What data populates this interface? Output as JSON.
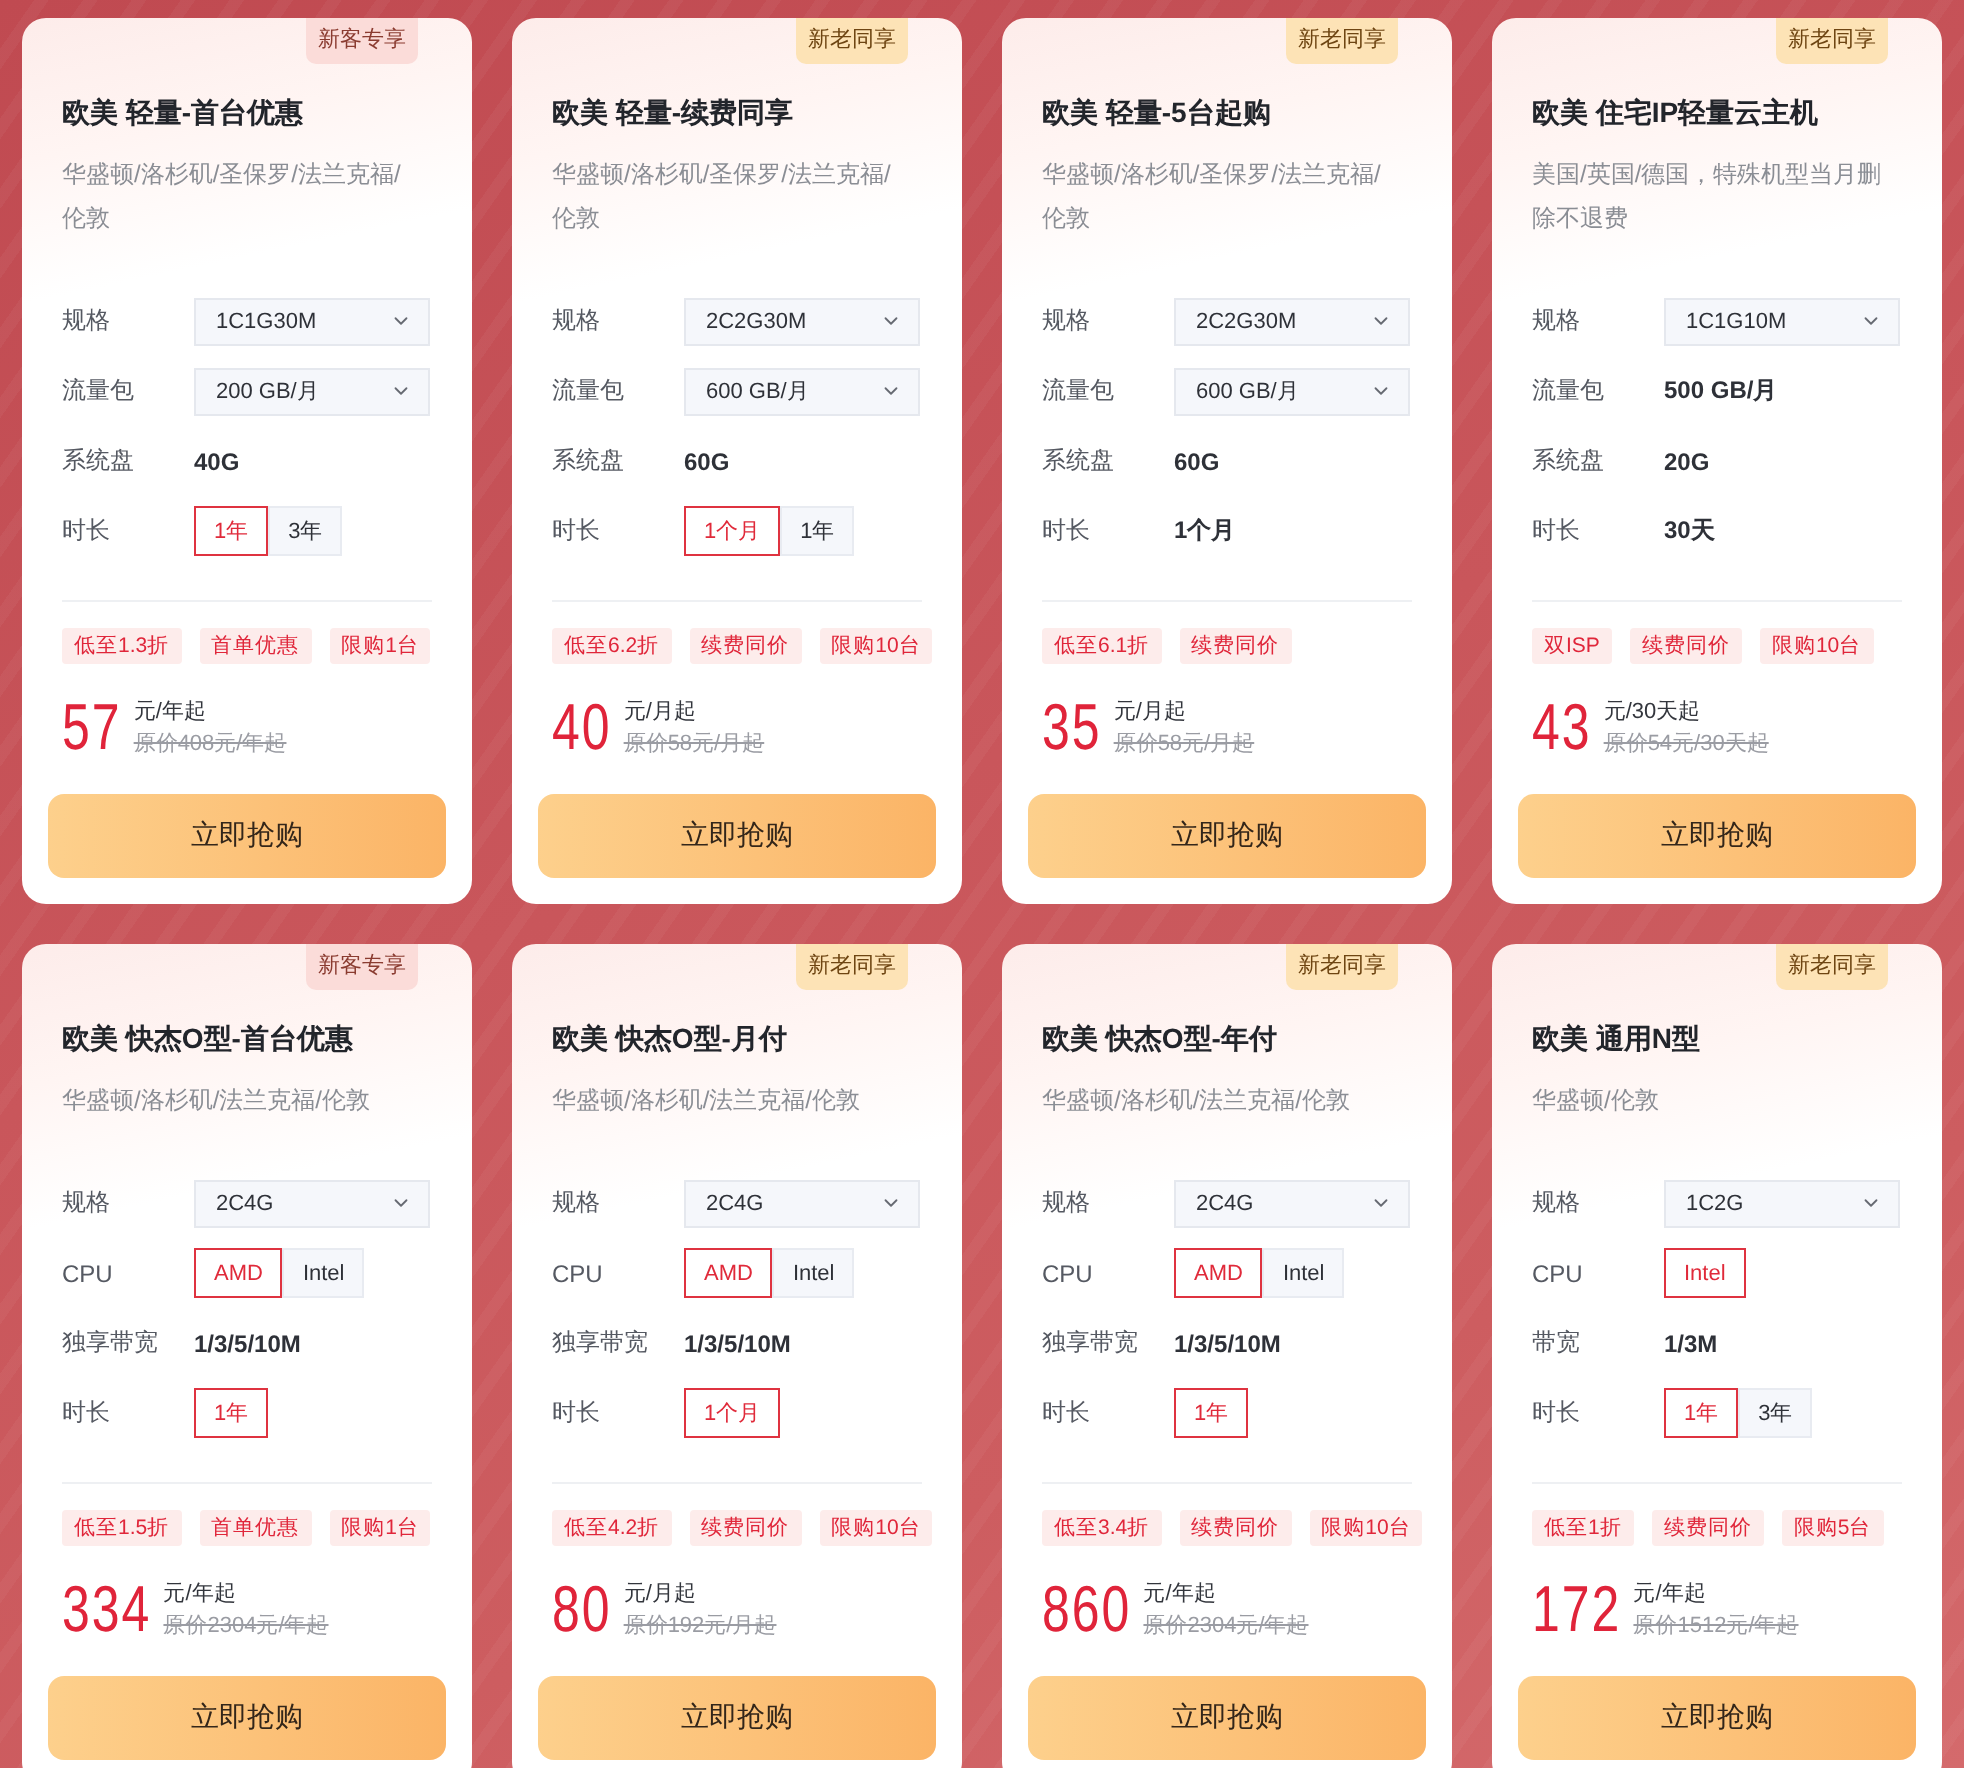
{
  "cards": [
    {
      "badge": {
        "text": "新客专享",
        "kind": "new"
      },
      "title": "欧美 轻量-首台优惠",
      "regions": "华盛顿/洛杉矶/圣保罗/法兰克福/伦敦",
      "specs": [
        {
          "label": "规格",
          "kind": "select",
          "value": "1C1G30M"
        },
        {
          "label": "流量包",
          "kind": "select",
          "value": "200 GB/月"
        },
        {
          "label": "系统盘",
          "kind": "text",
          "value": "40G"
        },
        {
          "label": "时长",
          "kind": "options",
          "options": [
            {
              "label": "1年",
              "selected": true
            },
            {
              "label": "3年",
              "selected": false
            }
          ]
        }
      ],
      "tags": [
        "低至1.3折",
        "首单优惠",
        "限购1台"
      ],
      "price": "57",
      "unit": "元/年起",
      "original_price": "原价408元/年起",
      "button": "立即抢购"
    },
    {
      "badge": {
        "text": "新老同享",
        "kind": "shared"
      },
      "title": "欧美 轻量-续费同享",
      "regions": "华盛顿/洛杉矶/圣保罗/法兰克福/伦敦",
      "specs": [
        {
          "label": "规格",
          "kind": "select",
          "value": "2C2G30M"
        },
        {
          "label": "流量包",
          "kind": "select",
          "value": "600 GB/月"
        },
        {
          "label": "系统盘",
          "kind": "text",
          "value": "60G"
        },
        {
          "label": "时长",
          "kind": "options",
          "options": [
            {
              "label": "1个月",
              "selected": true
            },
            {
              "label": "1年",
              "selected": false
            }
          ]
        }
      ],
      "tags": [
        "低至6.2折",
        "续费同价",
        "限购10台"
      ],
      "price": "40",
      "unit": "元/月起",
      "original_price": "原价58元/月起",
      "button": "立即抢购"
    },
    {
      "badge": {
        "text": "新老同享",
        "kind": "shared"
      },
      "title": "欧美 轻量-5台起购",
      "regions": "华盛顿/洛杉矶/圣保罗/法兰克福/伦敦",
      "specs": [
        {
          "label": "规格",
          "kind": "select",
          "value": "2C2G30M"
        },
        {
          "label": "流量包",
          "kind": "select",
          "value": "600 GB/月"
        },
        {
          "label": "系统盘",
          "kind": "text",
          "value": "60G"
        },
        {
          "label": "时长",
          "kind": "text",
          "value": "1个月"
        }
      ],
      "tags": [
        "低至6.1折",
        "续费同价"
      ],
      "price": "35",
      "unit": "元/月起",
      "original_price": "原价58元/月起",
      "button": "立即抢购"
    },
    {
      "badge": {
        "text": "新老同享",
        "kind": "shared"
      },
      "title": "欧美 住宅IP轻量云主机",
      "regions": "美国/英国/德国，特殊机型当月删除不退费",
      "specs": [
        {
          "label": "规格",
          "kind": "select",
          "value": "1C1G10M"
        },
        {
          "label": "流量包",
          "kind": "text",
          "value": "500 GB/月"
        },
        {
          "label": "系统盘",
          "kind": "text",
          "value": "20G"
        },
        {
          "label": "时长",
          "kind": "text",
          "value": "30天"
        }
      ],
      "tags": [
        "双ISP",
        "续费同价",
        "限购10台"
      ],
      "price": "43",
      "unit": "元/30天起",
      "original_price": "原价54元/30天起",
      "button": "立即抢购"
    },
    {
      "badge": {
        "text": "新客专享",
        "kind": "new"
      },
      "title": "欧美 快杰O型-首台优惠",
      "regions": "华盛顿/洛杉矶/法兰克福/伦敦",
      "specs": [
        {
          "label": "规格",
          "kind": "select",
          "value": "2C4G"
        },
        {
          "label": "CPU",
          "kind": "options",
          "options": [
            {
              "label": "AMD",
              "selected": true
            },
            {
              "label": "Intel",
              "selected": false
            }
          ]
        },
        {
          "label": "独享带宽",
          "kind": "text",
          "value": "1/3/5/10M"
        },
        {
          "label": "时长",
          "kind": "options",
          "options": [
            {
              "label": "1年",
              "selected": true
            }
          ]
        }
      ],
      "tags": [
        "低至1.5折",
        "首单优惠",
        "限购1台"
      ],
      "price": "334",
      "unit": "元/年起",
      "original_price": "原价2304元/年起",
      "button": "立即抢购"
    },
    {
      "badge": {
        "text": "新老同享",
        "kind": "shared"
      },
      "title": "欧美 快杰O型-月付",
      "regions": "华盛顿/洛杉矶/法兰克福/伦敦",
      "specs": [
        {
          "label": "规格",
          "kind": "select",
          "value": "2C4G"
        },
        {
          "label": "CPU",
          "kind": "options",
          "options": [
            {
              "label": "AMD",
              "selected": true
            },
            {
              "label": "Intel",
              "selected": false
            }
          ]
        },
        {
          "label": "独享带宽",
          "kind": "text",
          "value": "1/3/5/10M"
        },
        {
          "label": "时长",
          "kind": "options",
          "options": [
            {
              "label": "1个月",
              "selected": true
            }
          ]
        }
      ],
      "tags": [
        "低至4.2折",
        "续费同价",
        "限购10台"
      ],
      "price": "80",
      "unit": "元/月起",
      "original_price": "原价192元/月起",
      "button": "立即抢购"
    },
    {
      "badge": {
        "text": "新老同享",
        "kind": "shared"
      },
      "title": "欧美 快杰O型-年付",
      "regions": "华盛顿/洛杉矶/法兰克福/伦敦",
      "specs": [
        {
          "label": "规格",
          "kind": "select",
          "value": "2C4G"
        },
        {
          "label": "CPU",
          "kind": "options",
          "options": [
            {
              "label": "AMD",
              "selected": true
            },
            {
              "label": "Intel",
              "selected": false
            }
          ]
        },
        {
          "label": "独享带宽",
          "kind": "text",
          "value": "1/3/5/10M"
        },
        {
          "label": "时长",
          "kind": "options",
          "options": [
            {
              "label": "1年",
              "selected": true
            }
          ]
        }
      ],
      "tags": [
        "低至3.4折",
        "续费同价",
        "限购10台"
      ],
      "price": "860",
      "unit": "元/年起",
      "original_price": "原价2304元/年起",
      "button": "立即抢购"
    },
    {
      "badge": {
        "text": "新老同享",
        "kind": "shared"
      },
      "title": "欧美 通用N型",
      "regions": "华盛顿/伦敦",
      "specs": [
        {
          "label": "规格",
          "kind": "select",
          "value": "1C2G"
        },
        {
          "label": "CPU",
          "kind": "options",
          "options": [
            {
              "label": "Intel",
              "selected": true
            }
          ]
        },
        {
          "label": "带宽",
          "kind": "text",
          "value": "1/3M"
        },
        {
          "label": "时长",
          "kind": "options",
          "options": [
            {
              "label": "1年",
              "selected": true
            },
            {
              "label": "3年",
              "selected": false
            }
          ]
        }
      ],
      "tags": [
        "低至1折",
        "续费同价",
        "限购5台"
      ],
      "price": "172",
      "unit": "元/年起",
      "original_price": "原价1512元/年起",
      "button": "立即抢购"
    }
  ]
}
